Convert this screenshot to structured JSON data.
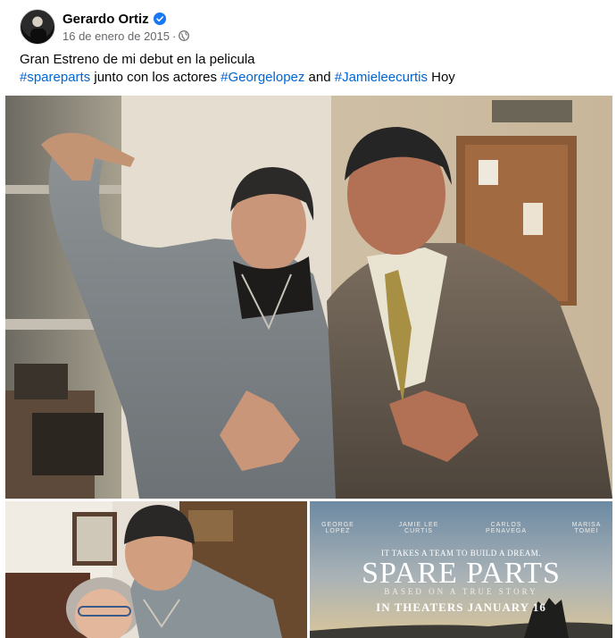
{
  "post": {
    "author": "Gerardo Ortiz",
    "date": "16 de enero de 2015",
    "separator": "·",
    "verified_icon": "verified-badge-icon",
    "privacy_icon": "globe-icon"
  },
  "caption": {
    "line1": "Gran Estreno de mi debut en la pelicula",
    "tag1": "#spareparts",
    "text1": " junto con los actores ",
    "tag2": "#Georgelopez",
    "text2": " and ",
    "tag3": "#Jamieleecurtis",
    "text3": " Hoy"
  },
  "poster": {
    "credits": [
      "GEORGE LOPEZ",
      "JAMIE LEE CURTIS",
      "CARLOS PENAVEGA",
      "MARISA TOMEI"
    ],
    "tagline": "IT TAKES A TEAM TO BUILD A DREAM.",
    "title": "SPARE PARTS",
    "subtitle": "BASED ON A TRUE STORY",
    "release": "IN THEATERS JANUARY 16"
  },
  "colors": {
    "link": "#0064d1",
    "text": "#050505",
    "secondary": "#65676b",
    "verified": "#1877f2"
  }
}
